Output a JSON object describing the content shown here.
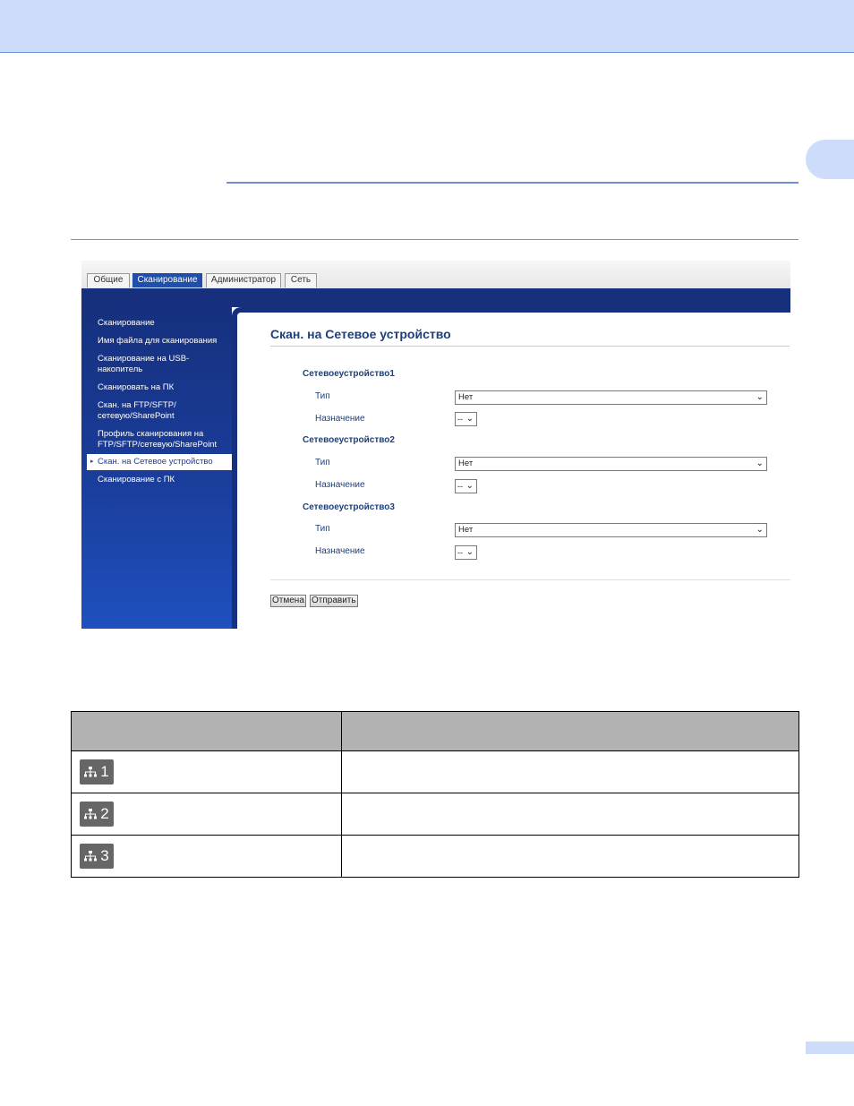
{
  "browser": {
    "tabs": [
      {
        "label": "Общие"
      },
      {
        "label": "Сканирование"
      },
      {
        "label": "Администратор"
      },
      {
        "label": "Сеть"
      }
    ]
  },
  "sidebar": {
    "items": [
      {
        "label": "Сканирование"
      },
      {
        "label": "Имя файла для сканирования"
      },
      {
        "label": "Сканирование на USB-накопитель"
      },
      {
        "label": "Сканировать на ПК"
      },
      {
        "label": "Скан. на FTP/SFTP/сетевую/SharePoint"
      },
      {
        "label": "Профиль сканирования на FTP/SFTP/сетевую/SharePoint"
      },
      {
        "label": "Скан. на Сетевое устройство"
      },
      {
        "label": "Сканирование с ПК"
      }
    ]
  },
  "main": {
    "title": "Скан. на Сетевое устройство",
    "devices": [
      {
        "heading": "Сетевоеустройство1",
        "type_label": "Тип",
        "type_value": "Нет",
        "dest_label": "Назначение",
        "dest_value": "--"
      },
      {
        "heading": "Сетевоеустройство2",
        "type_label": "Тип",
        "type_value": "Нет",
        "dest_label": "Назначение",
        "dest_value": "--"
      },
      {
        "heading": "Сетевоеустройство3",
        "type_label": "Тип",
        "type_value": "Нет",
        "dest_label": "Назначение",
        "dest_value": "--"
      }
    ],
    "cancel_label": "Отмена",
    "submit_label": "Отправить"
  },
  "table": {
    "rows": [
      {
        "icon_number": "1",
        "icon": "network-icon"
      },
      {
        "icon_number": "2",
        "icon": "network-icon"
      },
      {
        "icon_number": "3",
        "icon": "network-icon"
      }
    ]
  },
  "colors": {
    "band": "#cddcfb",
    "rule": "#6f8fd6",
    "nav_blue": "#16307e",
    "title_blue": "#1d3f7c",
    "table_header": "#b2b2b2",
    "icon_bg": "#666666"
  }
}
